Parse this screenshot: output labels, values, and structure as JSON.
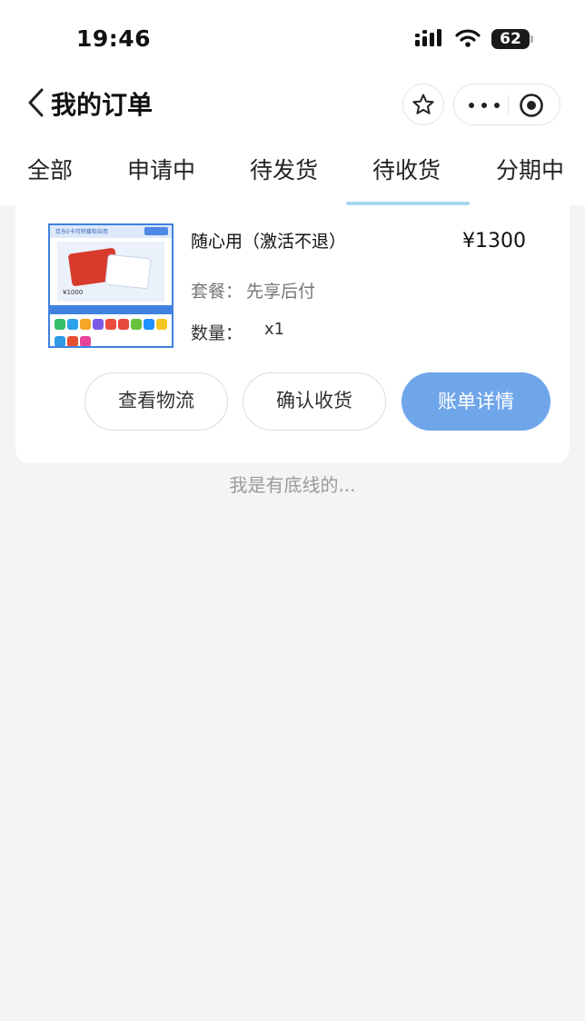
{
  "status_bar": {
    "time": "19:46",
    "battery": "62",
    "icons": [
      "signal-icon",
      "wifi-icon",
      "battery-icon"
    ]
  },
  "nav": {
    "back_icon": "chevron-left-icon",
    "title": "我的订单",
    "star_icon": "star-icon",
    "more_icon": "more-dots-icon",
    "close_icon": "target-circle-icon"
  },
  "tabs": [
    {
      "label": "全部",
      "active": false
    },
    {
      "label": "申请中",
      "active": false
    },
    {
      "label": "待发货",
      "active": false
    },
    {
      "label": "待收货",
      "active": true
    },
    {
      "label": "分期中",
      "active": false
    }
  ],
  "order": {
    "product_name": "随心用（激活不退）",
    "price": "¥1300",
    "package_label": "套餐：",
    "package_value": "先享后付",
    "quantity_label": "数量：",
    "quantity_value": "x1",
    "thumbnail": {
      "header_text": "京东E卡可转赠和自用",
      "price_text": "¥1000"
    },
    "buttons": {
      "logistics": "查看物流",
      "confirm": "确认收货",
      "bill": "账单详情"
    }
  },
  "footer": {
    "end_text": "我是有底线的..."
  },
  "colors": {
    "accent": "#6fa6ea",
    "tab_underline": "#a9d6ee",
    "background": "#f3f4f6"
  }
}
